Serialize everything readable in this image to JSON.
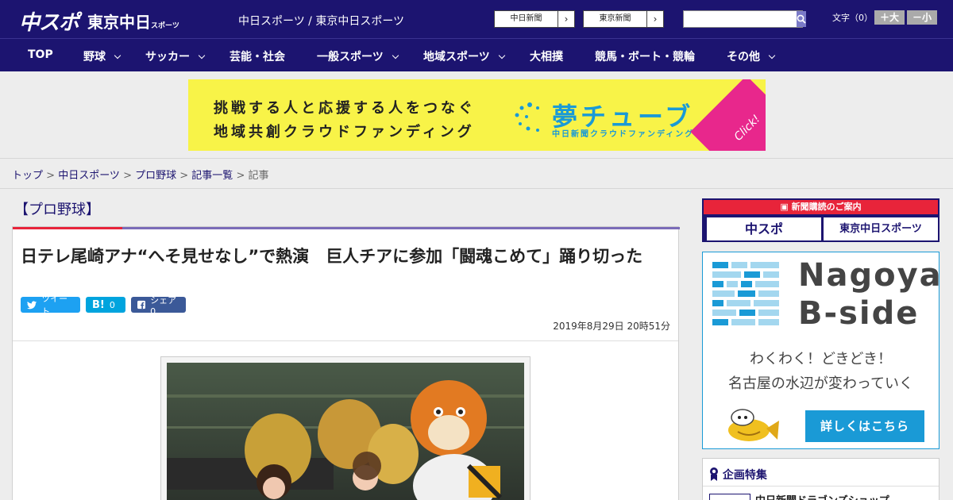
{
  "header": {
    "logo_main": "中スポ",
    "logo_tokyo": "東京中日",
    "logo_tokyo_small": "スポーツ",
    "site_name": "中日スポーツ / 東京中日スポーツ",
    "ext_links": [
      "中日新聞",
      "東京新聞"
    ],
    "search_placeholder": "",
    "font_size_label": "文字（0）",
    "font_larger": "＋大",
    "font_smaller": "－小"
  },
  "nav": {
    "items": [
      {
        "label": "TOP",
        "dropdown": false
      },
      {
        "label": "野球",
        "dropdown": true
      },
      {
        "label": "サッカー",
        "dropdown": true
      },
      {
        "label": "芸能・社会",
        "dropdown": false
      },
      {
        "label": "一般スポーツ",
        "dropdown": true
      },
      {
        "label": "地域スポーツ",
        "dropdown": true
      },
      {
        "label": "大相撲",
        "dropdown": false
      },
      {
        "label": "競馬・ボート・競輪",
        "dropdown": false
      },
      {
        "label": "その他",
        "dropdown": true
      }
    ]
  },
  "banner": {
    "line1": "挑戦する人と応援する人をつなぐ",
    "line2": "地域共創クラウドファンディング",
    "brand": "夢チューブ",
    "brand_sub": "中日新聞クラウドファンディング",
    "click": "Click!",
    "brand_color": "#1a9ad6",
    "bg_color": "#f8f348"
  },
  "breadcrumb": {
    "items": [
      "トップ",
      "中日スポーツ",
      "プロ野球",
      "記事一覧"
    ],
    "current": "記事",
    "sep": " > "
  },
  "article": {
    "category": "【プロ野球】",
    "title": "日テレ尾崎アナ“へそ見せなし”で熱演　巨人チアに参加「闘魂こめて」踊り切った",
    "share_tweet": "ツイート",
    "share_hatena": "B!",
    "share_hatena_count": "0",
    "share_facebook": "シェア 0",
    "date": "2019年8月29日 20時51分"
  },
  "sidebar": {
    "subscribe_header": "新聞購読のご案内",
    "subscribe_a": "中スポ",
    "subscribe_b": "東京中日スポーツ",
    "bside_title1": "Nagoya",
    "bside_title2": "B-side",
    "bside_copy1": "わくわく！どきどき！",
    "bside_copy2": "名古屋の水辺が変わっていく",
    "bside_more": "詳しくはこちら",
    "feature_header": "企画特集",
    "feature_item": "中日新聞ドラゴンズショップ"
  },
  "colors": {
    "navy": "#1c1470",
    "accent_red": "#e8243a",
    "twitter": "#1da1f2",
    "hatena": "#00a4de",
    "facebook": "#3b5998"
  }
}
